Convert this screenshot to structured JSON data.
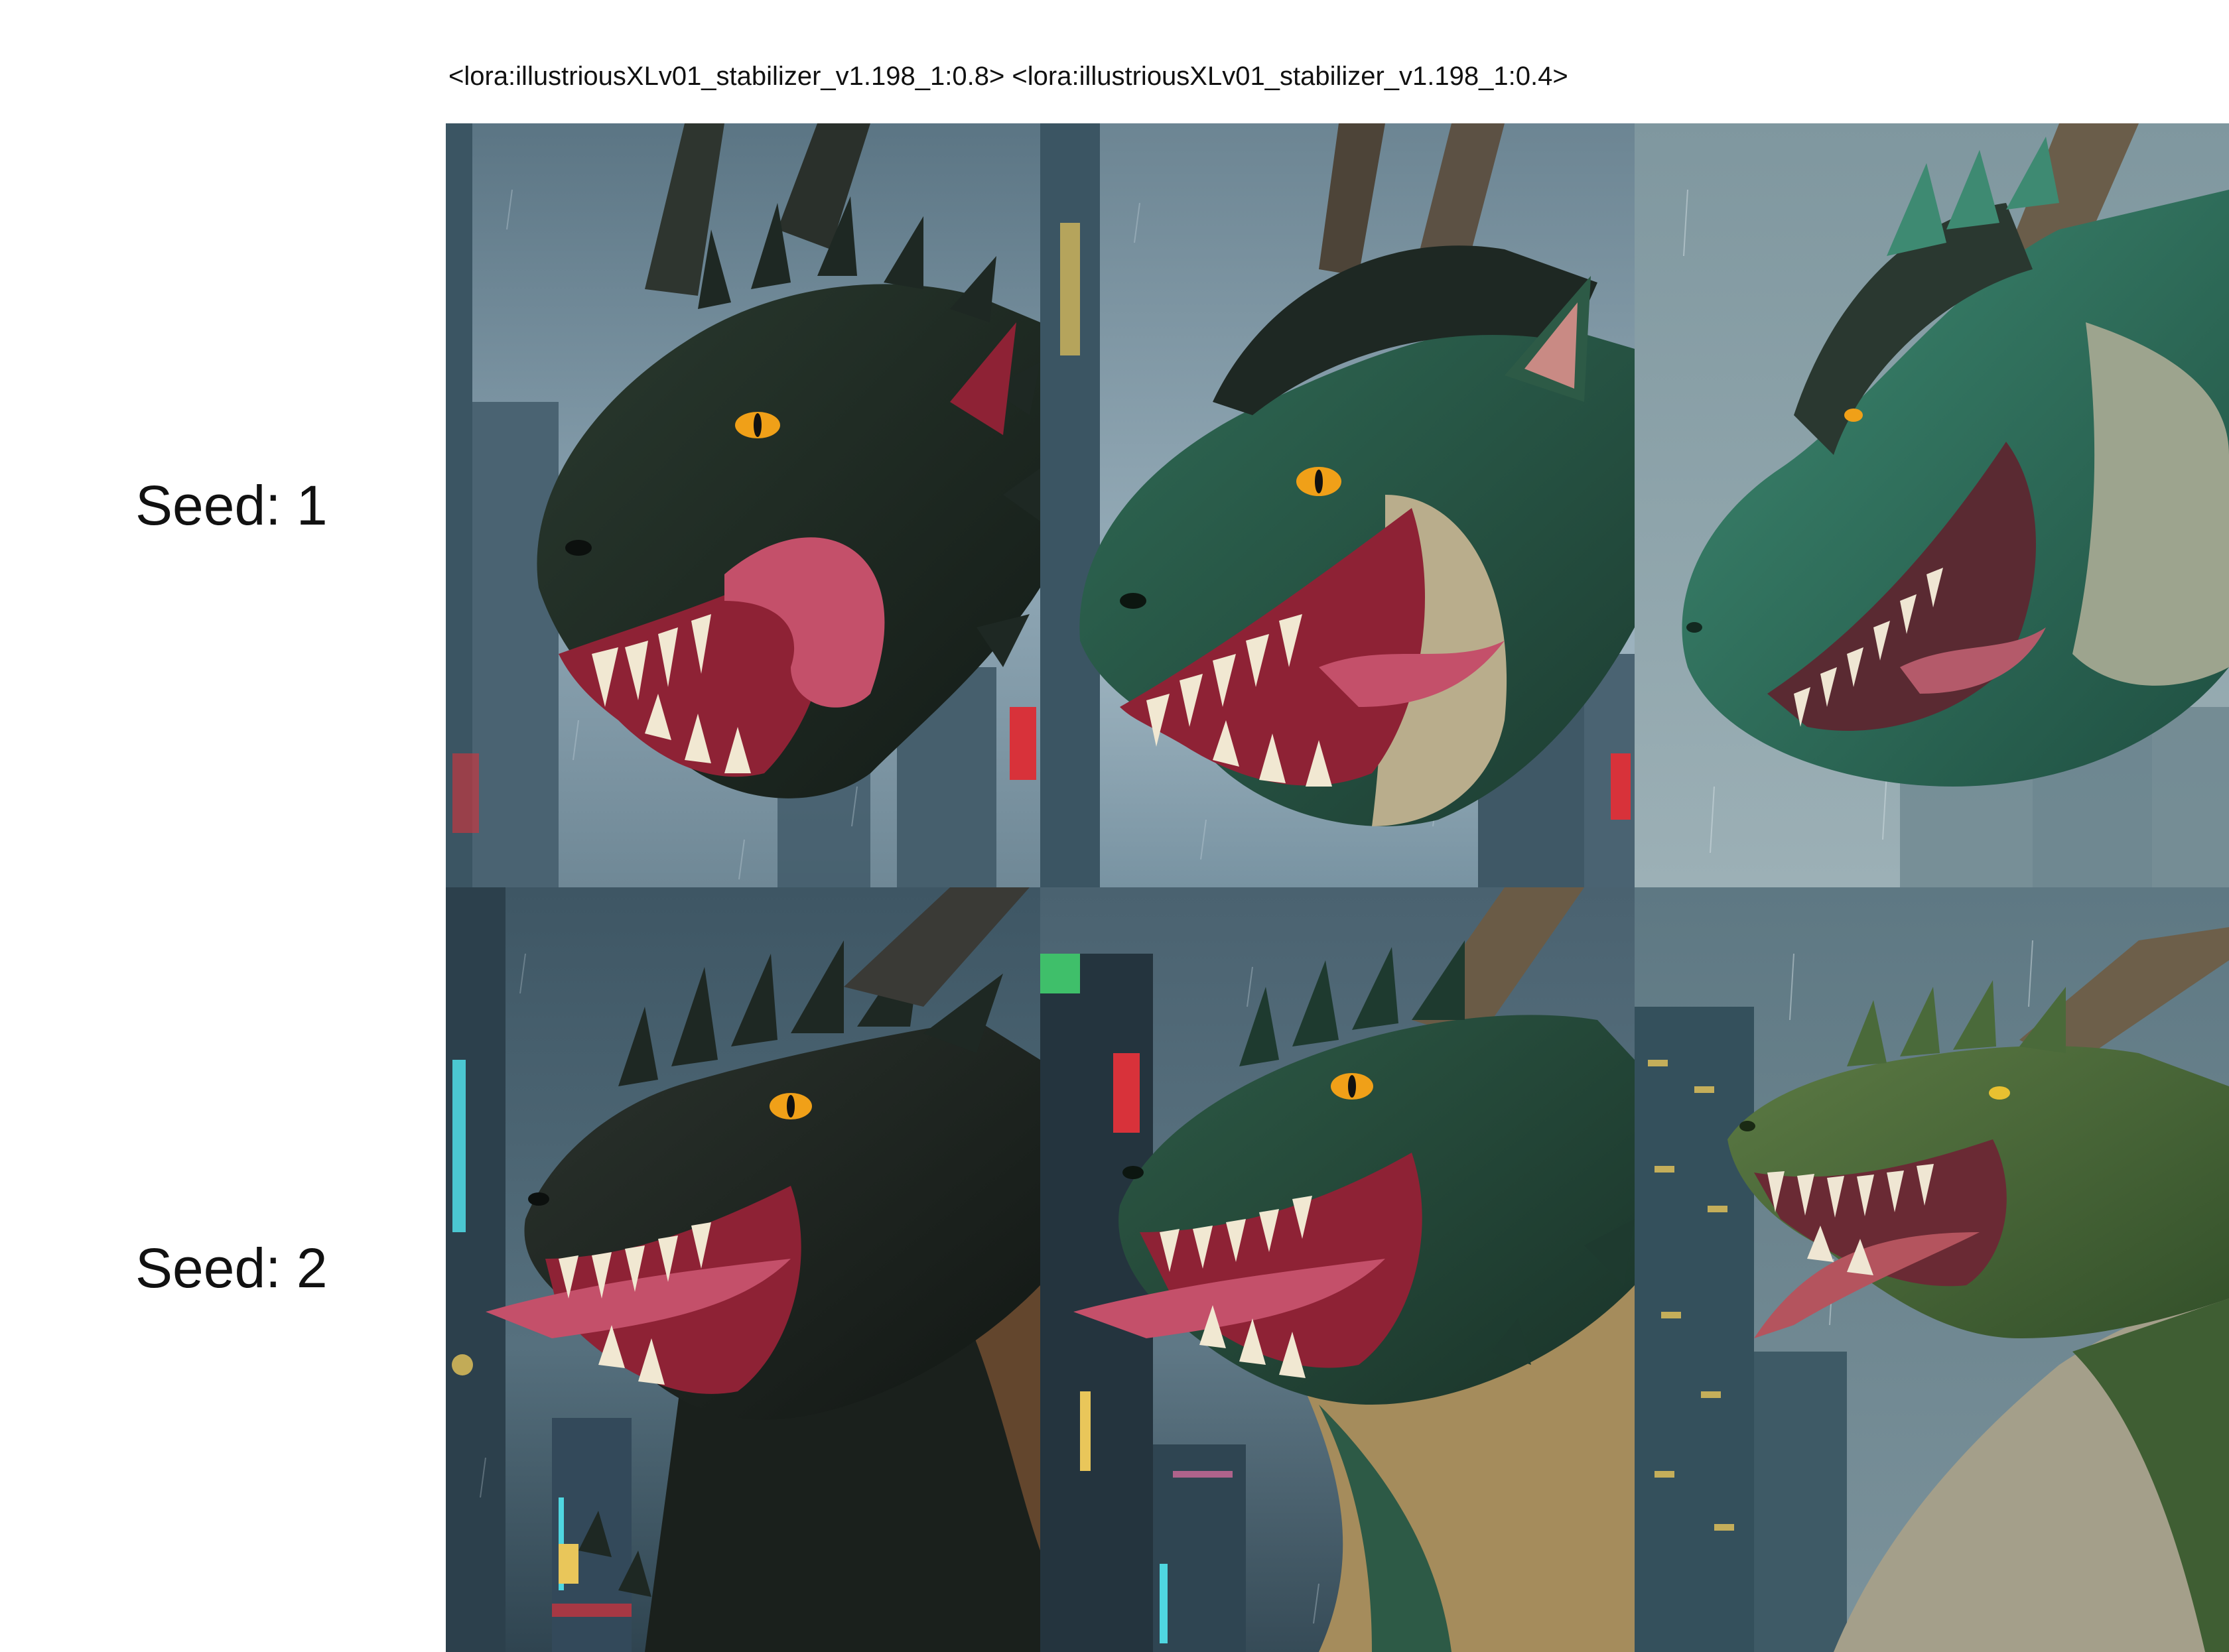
{
  "header": {
    "text": "<lora:illustriousXLv01_stabilizer_v1.198_1:0.8> <lora:illustriousXLv01_stabilizer_v1.198_1:0.4>"
  },
  "rows": [
    {
      "label": "Seed: 1"
    },
    {
      "label": "Seed: 2"
    }
  ],
  "colors": {
    "sky": "#8ea6b4",
    "sky_dark": "#4a6372",
    "building": "#3b5563",
    "scale_black": "#1e2823",
    "scale_green": "#2d5a46",
    "scale_olive": "#4d6a3a",
    "belly": "#b9ad8c",
    "mouth": "#8e2235",
    "tongue": "#c4506a",
    "tooth": "#f1e8d2",
    "eye": "#f0a018",
    "neon_red": "#d8323a",
    "neon_cyan": "#4fd6e0",
    "neon_yellow": "#e9c65a"
  },
  "images": [
    {
      "icon": "dragon-head-black-green-rain-city-image"
    },
    {
      "icon": "dragon-head-green-tan-rain-city-image"
    },
    {
      "icon": "dragon-head-teal-soft-rain-city-image"
    },
    {
      "icon": "dragon-black-long-neck-rain-city-image"
    },
    {
      "icon": "dragon-green-tan-neck-rain-city-image"
    },
    {
      "icon": "dragon-olive-painterly-rain-city-image"
    }
  ]
}
